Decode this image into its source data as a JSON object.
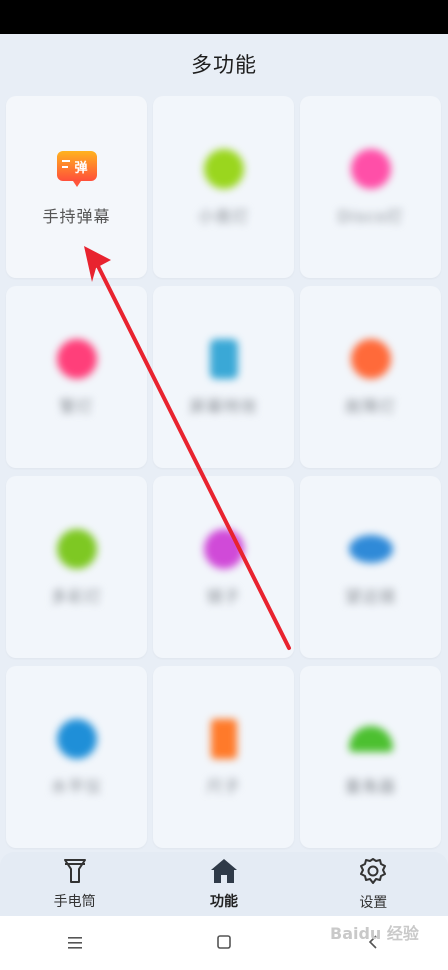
{
  "header": {
    "title": "多功能"
  },
  "tiles": [
    {
      "label": "手持弹幕",
      "icon": "danmaku-icon",
      "color": "#ff8a1f",
      "blurred": false
    },
    {
      "label": "小夜灯",
      "icon": "bulb-icon",
      "color": "#9ad61e",
      "blurred": true
    },
    {
      "label": "Disco灯",
      "icon": "disco-icon",
      "color": "#ff4fa8",
      "blurred": true
    },
    {
      "label": "警灯",
      "icon": "alarm-icon",
      "color": "#ff3f7a",
      "blurred": true
    },
    {
      "label": "屏幕特效",
      "icon": "screen-icon",
      "color": "#3aa8d6",
      "blurred": true
    },
    {
      "label": "故障灯",
      "icon": "warning-icon",
      "color": "#ff6a3a",
      "blurred": true
    },
    {
      "label": "多彩灯",
      "icon": "color-icon",
      "color": "#7ec823",
      "blurred": true
    },
    {
      "label": "镜子",
      "icon": "mirror-icon",
      "color": "#d04ad8",
      "blurred": true
    },
    {
      "label": "望远镜",
      "icon": "binocular-icon",
      "color": "#2f8ad8",
      "blurred": true
    },
    {
      "label": "水平仪",
      "icon": "level-icon",
      "color": "#1f8fd8",
      "blurred": true
    },
    {
      "label": "尺子",
      "icon": "ruler-icon",
      "color": "#ff7a2a",
      "blurred": true
    },
    {
      "label": "量角器",
      "icon": "protractor-icon",
      "color": "#4cc030",
      "blurred": true
    }
  ],
  "bottom_nav": [
    {
      "label": "手电筒",
      "icon": "flashlight-icon"
    },
    {
      "label": "功能",
      "icon": "home-icon"
    },
    {
      "label": "设置",
      "icon": "gear-icon"
    }
  ],
  "watermark": "Baidu 经验"
}
